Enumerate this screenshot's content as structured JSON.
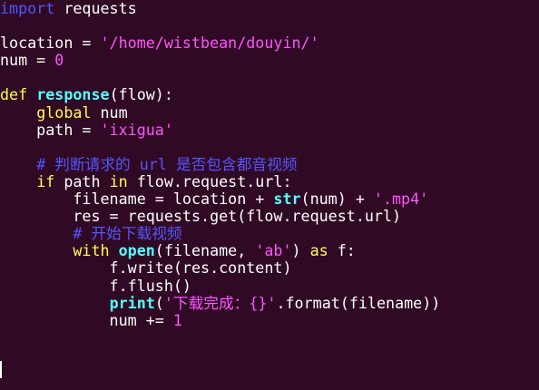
{
  "code": {
    "l1": {
      "kw": "import",
      "rest": " requests"
    },
    "l3": {
      "a": "location = ",
      "s": "'/home/wistbean/douyin/'"
    },
    "l4": {
      "a": "num = ",
      "n": "0"
    },
    "l6": {
      "kw": "def",
      "sp": " ",
      "fn": "response",
      "rest": "(flow):"
    },
    "l7": {
      "ind": "    ",
      "kw": "global",
      "rest": " num"
    },
    "l8": {
      "a": "    path = ",
      "s": "'ixigua'"
    },
    "l10": {
      "ind": "    ",
      "cm": "# 判断请求的 url 是否包含都音视频"
    },
    "l11": {
      "ind": "    ",
      "kw": "if",
      "a": " path ",
      "kw2": "in",
      "b": " flow.request.url:"
    },
    "l12": {
      "a": "        filename = location + ",
      "fn": "str",
      "b": "(num) + ",
      "s": "'.mp4'"
    },
    "l13": {
      "a": "        res = requests.get(flow.request.url)"
    },
    "l14": {
      "ind": "        ",
      "cm": "# 开始下载视频"
    },
    "l15": {
      "ind": "        ",
      "kw": "with",
      "sp": " ",
      "fn": "open",
      "a": "(filename, ",
      "s": "'ab'",
      "b": ") ",
      "kw2": "as",
      "c": " f:"
    },
    "l16": {
      "a": "            f.write(res.content)"
    },
    "l17": {
      "a": "            f.flush()"
    },
    "l18": {
      "ind": "            ",
      "fn": "print",
      "a": "(",
      "s": "'下载完成：{}'",
      "b": ".format(filename))"
    },
    "l19": {
      "a": "            num += ",
      "n": "1"
    }
  }
}
